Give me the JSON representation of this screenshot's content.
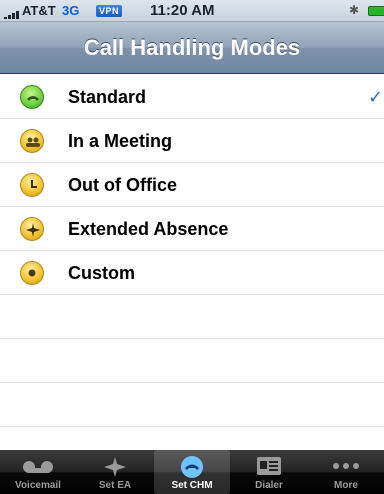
{
  "status_bar": {
    "carrier": "AT&T",
    "network": "3G",
    "vpn": "VPN",
    "time": "11:20 AM",
    "bluetooth": "✱"
  },
  "nav": {
    "title": "Call Handling Modes"
  },
  "modes": [
    {
      "label": "Standard",
      "icon": "phone-icon",
      "selected": true
    },
    {
      "label": "In a Meeting",
      "icon": "people-icon",
      "selected": false
    },
    {
      "label": "Out of Office",
      "icon": "clock-icon",
      "selected": false
    },
    {
      "label": "Extended Absence",
      "icon": "airplane-icon",
      "selected": false
    },
    {
      "label": "Custom",
      "icon": "dot-icon",
      "selected": false
    }
  ],
  "checkmark": "✓",
  "tabs": [
    {
      "label": "Voicemail",
      "icon": "voicemail-icon",
      "selected": false
    },
    {
      "label": "Set EA",
      "icon": "extended-absence-icon",
      "selected": false
    },
    {
      "label": "Set CHM",
      "icon": "phone-icon",
      "selected": true
    },
    {
      "label": "Dialer",
      "icon": "contact-card-icon",
      "selected": false
    },
    {
      "label": "More",
      "icon": "more-icon",
      "selected": false
    }
  ],
  "colors": {
    "accent_blue": "#3d6bb3",
    "mode_icon_yellow": "#f2c02a",
    "mode_icon_green": "#6bcf3a"
  }
}
